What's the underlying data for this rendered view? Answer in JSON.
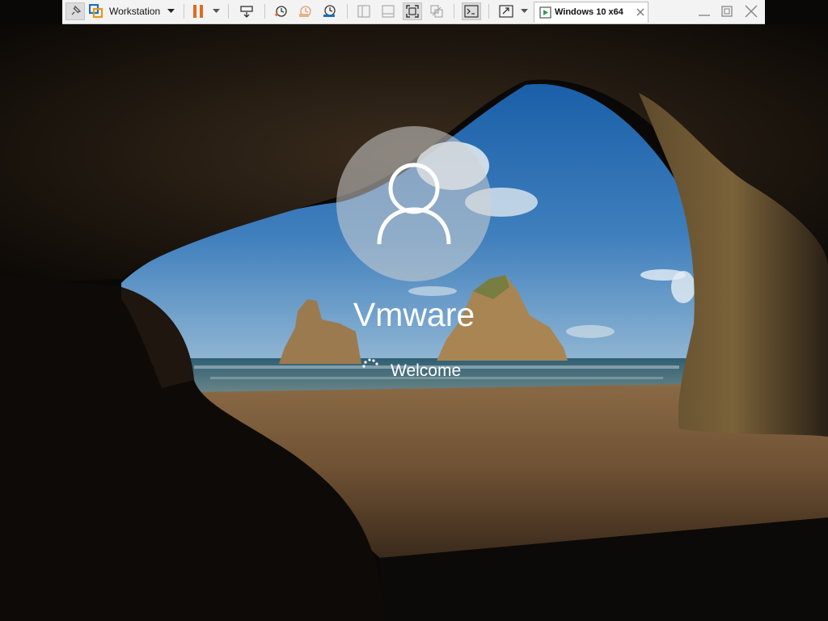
{
  "toolbar": {
    "product_label": "Workstation",
    "vm_tab_label": "Windows 10 x64",
    "icons": {
      "pin": "pin-icon",
      "product": "vmware-logo-icon",
      "product_menu": "chevron-down-icon",
      "pause": "pause-icon",
      "power_menu": "chevron-down-icon",
      "send_keys": "send-ctrl-alt-del-icon",
      "snapshot": "take-snapshot-icon",
      "revert": "revert-snapshot-icon",
      "manage_snapshots": "snapshot-manager-icon",
      "show_library": "library-panel-icon",
      "thumbnail_bar": "thumbnail-bar-icon",
      "full_screen": "full-screen-icon",
      "unity": "unity-icon",
      "console": "console-view-icon",
      "stretch": "stretch-guest-icon",
      "stretch_menu": "chevron-down-icon",
      "vm_tab": "vm-running-icon",
      "tab_close": "close-icon",
      "minimize": "minimize-icon",
      "restore": "restore-icon",
      "close": "close-window-icon"
    }
  },
  "login": {
    "username": "Vmware",
    "status": "Welcome",
    "avatar_icon": "user-avatar-icon",
    "spinner_icon": "loading-spinner-icon"
  },
  "colors": {
    "toolbar_bg": "#f3f3f3",
    "accent_orange": "#e06b1f",
    "vmware_blue": "#1c6dbf",
    "text_white": "#ffffff"
  }
}
